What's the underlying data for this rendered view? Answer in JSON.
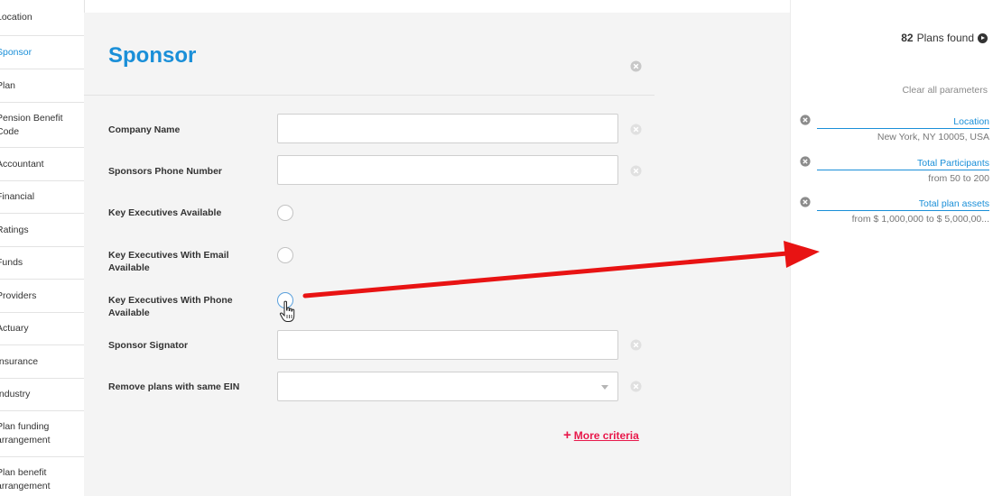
{
  "sidebar": {
    "items": [
      {
        "label": "Location"
      },
      {
        "label": "Sponsor"
      },
      {
        "label": "Plan"
      },
      {
        "label": "Pension Benefit Code"
      },
      {
        "label": "Accountant"
      },
      {
        "label": "Financial"
      },
      {
        "label": "Ratings"
      },
      {
        "label": "Funds"
      },
      {
        "label": "Providers"
      },
      {
        "label": "Actuary"
      },
      {
        "label": "Insurance"
      },
      {
        "label": "Industry"
      },
      {
        "label": "Plan funding arrangement"
      },
      {
        "label": "Plan benefit arrangement"
      }
    ],
    "active_index": 1
  },
  "panel": {
    "title": "Sponsor",
    "fields": [
      {
        "label": "Company Name",
        "type": "text",
        "value": ""
      },
      {
        "label": "Sponsors Phone Number",
        "type": "text",
        "value": ""
      },
      {
        "label": "Key Executives Available",
        "type": "radio",
        "checked": false
      },
      {
        "label": "Key Executives With Email Available",
        "type": "radio",
        "checked": false
      },
      {
        "label": "Key Executives With Phone Available",
        "type": "radio",
        "checked": false
      },
      {
        "label": "Sponsor Signator",
        "type": "text",
        "value": ""
      },
      {
        "label": "Remove plans with same EIN",
        "type": "select",
        "value": ""
      }
    ],
    "more_criteria": {
      "plus": "+",
      "label": "More criteria"
    }
  },
  "results": {
    "count": "82",
    "count_suffix": "Plans found",
    "clear_all": "Clear all parameters",
    "parameters": [
      {
        "name": "Location",
        "value": "New York, NY 10005, USA"
      },
      {
        "name": "Total Participants",
        "value": "from 50 to 200"
      },
      {
        "name": "Total plan assets",
        "value": "from $ 1,000,000 to $ 5,000,00..."
      }
    ]
  },
  "icons": {
    "clear": "close-circle-icon",
    "results_arrow": "arrow-right-circle-icon",
    "cursor": "hand-pointer-icon"
  },
  "colors": {
    "accent": "#1a8fd8",
    "more_criteria": "#e8194b",
    "annotation_arrow": "#e81313"
  }
}
